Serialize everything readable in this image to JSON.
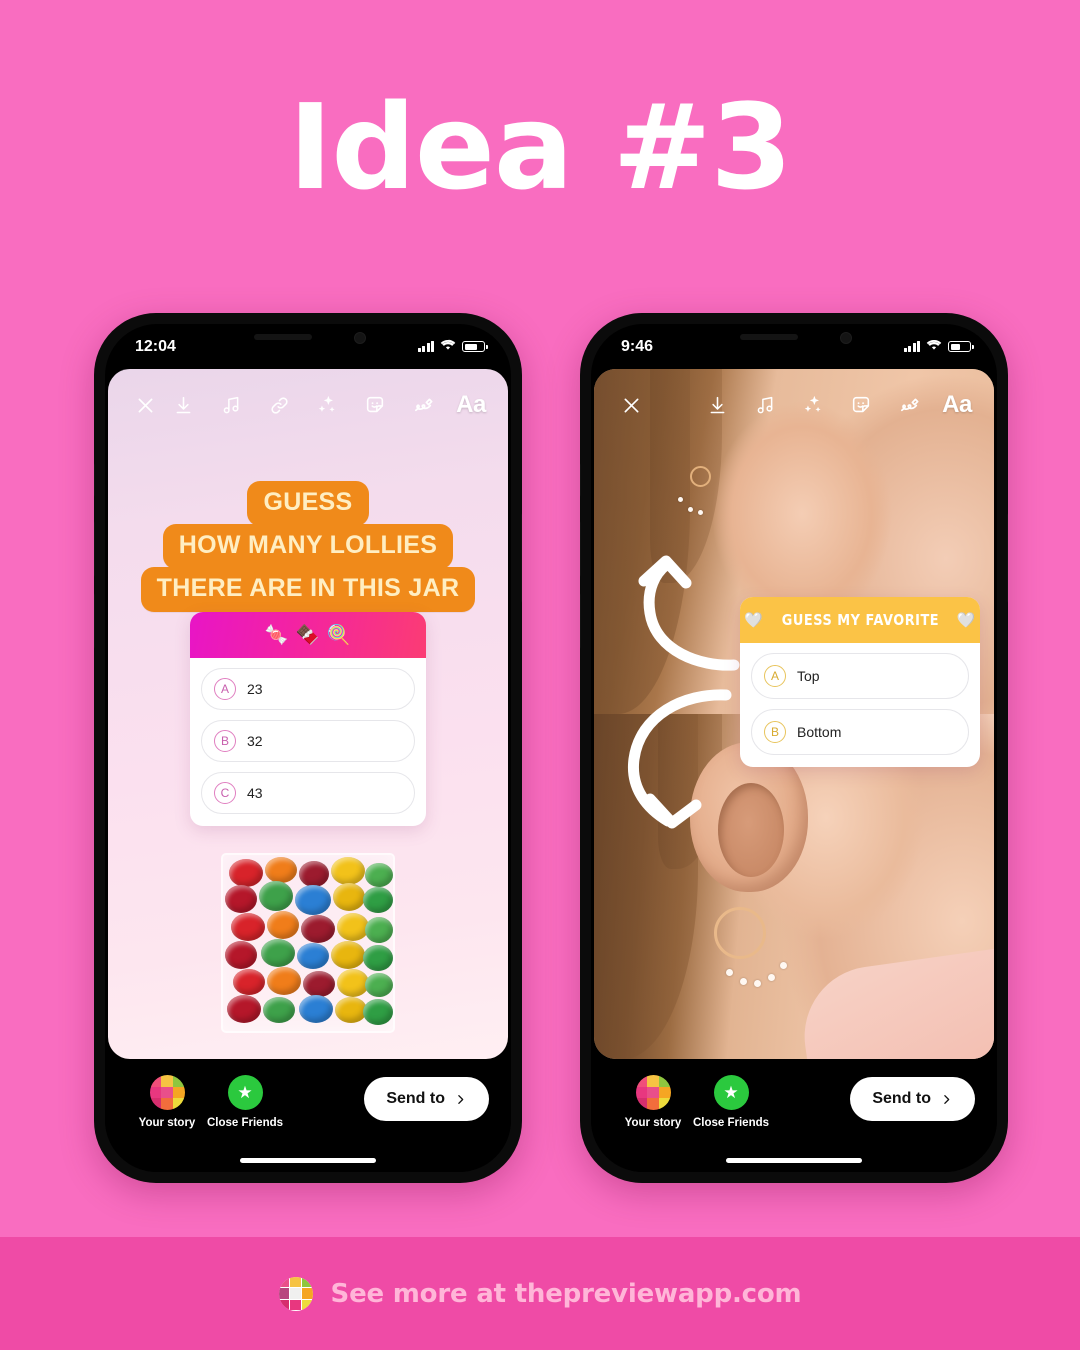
{
  "poster": {
    "title": "Idea #3",
    "background_color": "#f96dc0",
    "footer": {
      "text": "See more at thepreviewapp.com",
      "band_color": "#ef4ba6",
      "text_color": "#ffb6d8",
      "logo_name": "preview-app-logo"
    }
  },
  "phone_left": {
    "status": {
      "time": "12:04",
      "signal": "signal-bars",
      "wifi": "wifi-icon",
      "battery": "battery-icon"
    },
    "toolbar": [
      {
        "name": "close-icon",
        "label": "Close"
      },
      {
        "name": "download-icon",
        "label": "Save"
      },
      {
        "name": "music-icon",
        "label": "Music"
      },
      {
        "name": "link-icon",
        "label": "Link"
      },
      {
        "name": "sparkles-icon",
        "label": "Effects"
      },
      {
        "name": "sticker-icon",
        "label": "Stickers"
      },
      {
        "name": "draw-icon",
        "label": "Draw"
      },
      {
        "name": "text-aa-icon",
        "label": "Aa"
      }
    ],
    "caption": {
      "lines": [
        "GUESS",
        "HOW MANY LOLLIES",
        "THERE ARE IN THIS JAR"
      ],
      "bg_color": "#f08a1a",
      "text_color": "#ffeec2"
    },
    "quiz": {
      "header_emojis": "🍬 🍫 🍭",
      "header_gradient": [
        "#e815c6",
        "#fb3c74"
      ],
      "options": [
        {
          "letter": "A",
          "value": "23"
        },
        {
          "letter": "B",
          "value": "32"
        },
        {
          "letter": "C",
          "value": "43"
        }
      ]
    },
    "photo_description": "clear box of candy-coated chocolates",
    "actions": {
      "your_story": "Your story",
      "close_friends": "Close Friends",
      "send_to": "Send to"
    }
  },
  "phone_right": {
    "status": {
      "time": "9:46",
      "signal": "signal-bars",
      "wifi": "wifi-icon",
      "battery": "battery-icon"
    },
    "toolbar": [
      {
        "name": "close-icon",
        "label": "Close"
      },
      {
        "name": "download-icon",
        "label": "Save"
      },
      {
        "name": "music-icon",
        "label": "Music"
      },
      {
        "name": "sparkles-icon",
        "label": "Effects"
      },
      {
        "name": "sticker-icon",
        "label": "Stickers"
      },
      {
        "name": "draw-icon",
        "label": "Draw"
      },
      {
        "name": "text-aa-icon",
        "label": "Aa"
      }
    ],
    "quiz": {
      "header_text": "GUESS MY FAVORITE",
      "header_emoji_left": "🤍",
      "header_emoji_right": "🤍",
      "header_color": "#fbc346",
      "options": [
        {
          "letter": "A",
          "value": "Top"
        },
        {
          "letter": "B",
          "value": "Bottom"
        }
      ]
    },
    "photo_description": "woman's ear with two hoop earrings, white curved arrows pointing to each",
    "actions": {
      "your_story": "Your story",
      "close_friends": "Close Friends",
      "send_to": "Send to"
    }
  }
}
